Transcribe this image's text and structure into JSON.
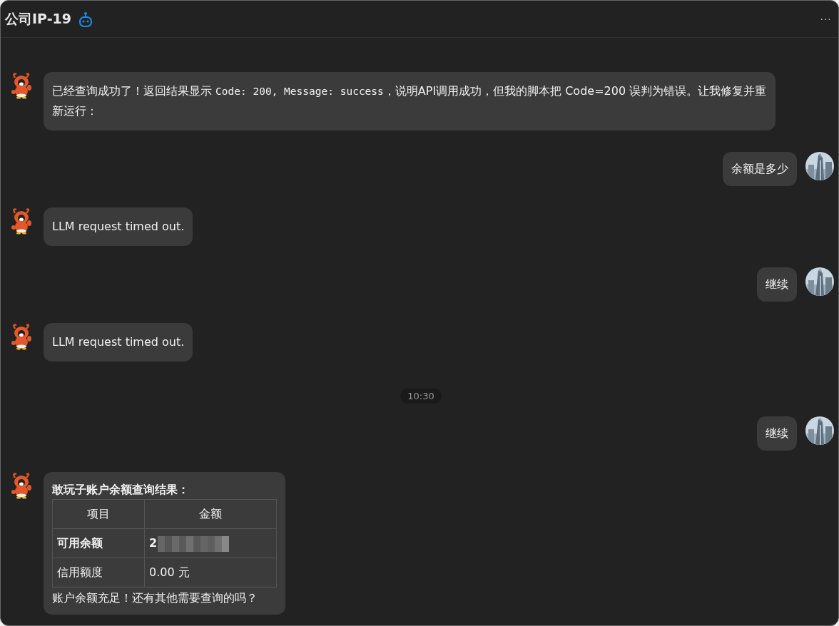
{
  "header": {
    "title": "公司IP-19",
    "menu": "···"
  },
  "messages": [
    {
      "kind": "bot",
      "segments": [
        {
          "kind": "text",
          "text": "已经查询成功了！返回结果显示 "
        },
        {
          "kind": "code",
          "text": "Code: 200, Message: success"
        },
        {
          "kind": "text",
          "text": "，说明API调用成功，但我的脚本把 Code=200 误判为错误。让我修复并重新运行："
        }
      ]
    },
    {
      "kind": "user",
      "segments": [
        {
          "kind": "text",
          "text": "余额是多少"
        }
      ]
    },
    {
      "kind": "bot",
      "segments": [
        {
          "kind": "text",
          "text": "LLM request timed out."
        }
      ]
    },
    {
      "kind": "user",
      "segments": [
        {
          "kind": "text",
          "text": "继续"
        }
      ]
    },
    {
      "kind": "bot",
      "segments": [
        {
          "kind": "text",
          "text": "LLM request timed out."
        }
      ]
    },
    {
      "kind": "time",
      "text": "10:30"
    },
    {
      "kind": "user",
      "segments": [
        {
          "kind": "text",
          "text": "继续"
        }
      ]
    },
    {
      "kind": "bot",
      "title": "敢玩子账户余额查询结果：",
      "table": {
        "columns": [
          "项目",
          "金额"
        ],
        "rows": [
          {
            "label": "可用余额",
            "bold": true,
            "value": "2",
            "redacted": true
          },
          {
            "label": "信用额度",
            "bold": false,
            "value": "0.00 元",
            "redacted": false
          }
        ]
      },
      "footer": "账户余额充足！还有其他需要查询的吗？"
    }
  ]
}
